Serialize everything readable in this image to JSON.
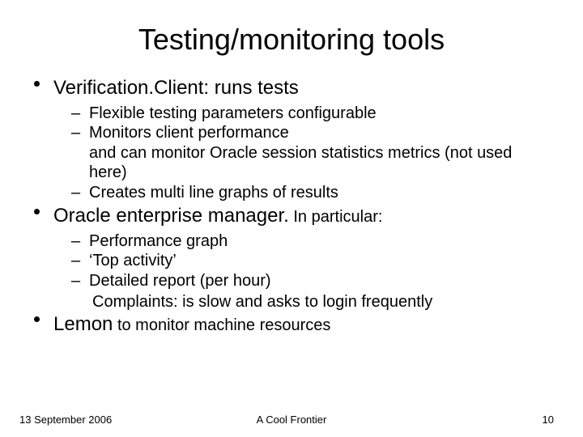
{
  "title": "Testing/monitoring tools",
  "bullets": [
    {
      "text": "Verification.Client: runs tests",
      "suffix": "",
      "sub": [
        "Flexible testing parameters configurable",
        "Monitors client performance\nand can monitor Oracle session statistics metrics (not used here)",
        "Creates multi line graphs of results"
      ],
      "trailing": ""
    },
    {
      "text": "Oracle enterprise manager.",
      "suffix": " In particular:",
      "sub": [
        "Performance graph",
        "‘Top activity’",
        "Detailed report (per hour)"
      ],
      "trailing": "Complaints: is slow and asks to login frequently"
    },
    {
      "text": "Lemon",
      "suffix": " to monitor machine resources",
      "sub": [],
      "trailing": ""
    }
  ],
  "footer": {
    "date": "13 September 2006",
    "center": "A Cool Frontier",
    "page": "10"
  }
}
